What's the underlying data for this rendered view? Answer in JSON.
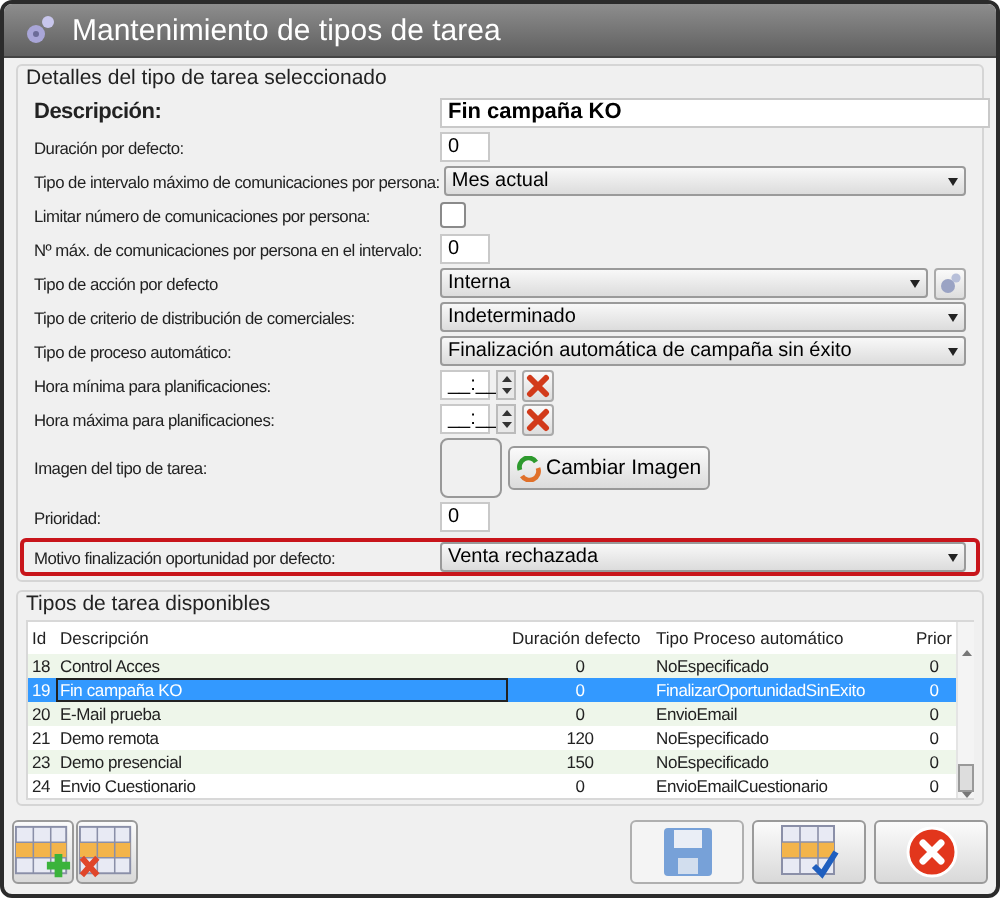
{
  "window": {
    "title": "Mantenimiento de tipos de tarea"
  },
  "details": {
    "title": "Detalles del tipo de tarea seleccionado",
    "fields": [
      {
        "kind": "heading",
        "label": "Descripción:",
        "value": "Fin campaña KO"
      },
      {
        "kind": "text",
        "label": "Duración por defecto:",
        "value": "0"
      },
      {
        "kind": "select",
        "label": "Tipo de intervalo máximo de comunicaciones por persona:",
        "value": "Mes actual"
      },
      {
        "kind": "checkbox",
        "label": "Limitar número de comunicaciones por persona:",
        "checked": false
      },
      {
        "kind": "text",
        "label": "Nº máx. de comunicaciones por persona en el intervalo:",
        "value": "0"
      },
      {
        "kind": "select_action",
        "label": "Tipo de acción por defecto",
        "value": "Interna"
      },
      {
        "kind": "select",
        "label": "Tipo de criterio de distribución de comerciales:",
        "value": "Indeterminado"
      },
      {
        "kind": "select",
        "label": "Tipo de proceso automático:",
        "value": "Finalización automática de campaña sin éxito"
      },
      {
        "kind": "time",
        "label": "Hora mínima para planificaciones:",
        "value": "__:__"
      },
      {
        "kind": "time",
        "label": "Hora máxima para planificaciones:",
        "value": "__:__"
      },
      {
        "kind": "image",
        "label": "Imagen del tipo de tarea:",
        "button": "Cambiar Imagen"
      },
      {
        "kind": "text",
        "label": "Prioridad:",
        "value": "0"
      },
      {
        "kind": "select",
        "label": "Motivo finalización oportunidad por defecto:",
        "value": "Venta rechazada",
        "highlighted": true
      }
    ]
  },
  "task_types": {
    "title": "Tipos de tarea disponibles",
    "columns": [
      "Id",
      "Descripción",
      "Duración defecto",
      "Tipo Proceso automático",
      "Prior"
    ],
    "rows": [
      {
        "cells": [
          "18",
          "Control Acces",
          "0",
          "NoEspecificado",
          "0"
        ],
        "selected": false
      },
      {
        "cells": [
          "19",
          "Fin campaña KO",
          "0",
          "FinalizarOportunidadSinExito",
          "0"
        ],
        "selected": true
      },
      {
        "cells": [
          "20",
          "E-Mail prueba",
          "0",
          "EnvioEmail",
          "0"
        ],
        "selected": false
      },
      {
        "cells": [
          "21",
          "Demo remota",
          "120",
          "NoEspecificado",
          "0"
        ],
        "selected": false
      },
      {
        "cells": [
          "23",
          "Demo presencial",
          "150",
          "NoEspecificado",
          "0"
        ],
        "selected": false
      },
      {
        "cells": [
          "24",
          "Envio Cuestionario",
          "0",
          "EnvioEmailCuestionario",
          "0"
        ],
        "selected": false
      }
    ]
  },
  "toolbar": {
    "save_disabled": true
  }
}
